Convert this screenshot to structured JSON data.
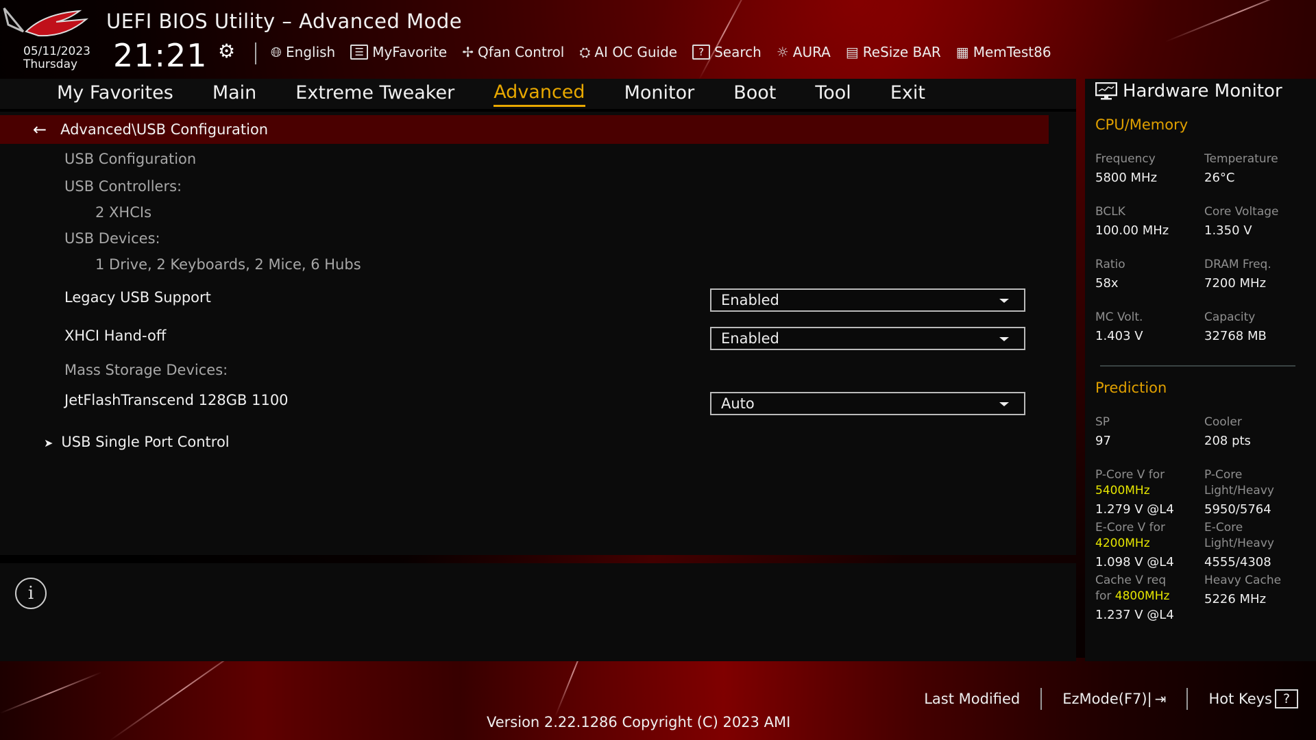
{
  "header": {
    "title": "UEFI BIOS Utility – Advanced Mode",
    "date": "05/11/2023",
    "weekday": "Thursday",
    "time": "21:21",
    "settings_icon": "gear-icon"
  },
  "toolbar": [
    {
      "label": "English",
      "icon": "globe-icon"
    },
    {
      "label": "MyFavorite",
      "icon": "favorite-list-icon"
    },
    {
      "label": "Qfan Control",
      "icon": "fan-icon"
    },
    {
      "label": "AI OC Guide",
      "icon": "ai-chip-icon"
    },
    {
      "label": "Search",
      "icon": "question-box-icon"
    },
    {
      "label": "AURA",
      "icon": "aura-light-icon"
    },
    {
      "label": "ReSize BAR",
      "icon": "gpu-card-icon"
    },
    {
      "label": "MemTest86",
      "icon": "memory-icon"
    }
  ],
  "tabs": [
    {
      "label": "My Favorites",
      "active": false
    },
    {
      "label": "Main",
      "active": false
    },
    {
      "label": "Extreme Tweaker",
      "active": false
    },
    {
      "label": "Advanced",
      "active": true
    },
    {
      "label": "Monitor",
      "active": false
    },
    {
      "label": "Boot",
      "active": false
    },
    {
      "label": "Tool",
      "active": false
    },
    {
      "label": "Exit",
      "active": false
    }
  ],
  "breadcrumb": "Advanced\\USB Configuration",
  "content": {
    "section_title": "USB Configuration",
    "controllers_label": "USB Controllers:",
    "controllers_value": "2 XHCIs",
    "devices_label": "USB Devices:",
    "devices_value": "1 Drive, 2 Keyboards, 2 Mice, 6 Hubs",
    "settings": [
      {
        "label": "Legacy USB Support",
        "value": "Enabled"
      },
      {
        "label": "XHCI Hand-off",
        "value": "Enabled"
      }
    ],
    "mass_storage_label": "Mass Storage Devices:",
    "mass_storage": [
      {
        "label": "JetFlashTranscend 128GB 1100",
        "value": "Auto"
      }
    ],
    "submenu": "USB Single Port Control"
  },
  "hardware_monitor": {
    "title": "Hardware Monitor",
    "cpu_memory": {
      "title": "CPU/Memory",
      "items": [
        {
          "label": "Frequency",
          "value": "5800 MHz"
        },
        {
          "label": "Temperature",
          "value": "26°C"
        },
        {
          "label": "BCLK",
          "value": "100.00 MHz"
        },
        {
          "label": "Core Voltage",
          "value": "1.350 V"
        },
        {
          "label": "Ratio",
          "value": "58x"
        },
        {
          "label": "DRAM Freq.",
          "value": "7200 MHz"
        },
        {
          "label": "MC Volt.",
          "value": "1.403 V"
        },
        {
          "label": "Capacity",
          "value": "32768 MB"
        }
      ]
    },
    "prediction": {
      "title": "Prediction",
      "sp_label": "SP",
      "sp_value": "97",
      "cooler_label": "Cooler",
      "cooler_value": "208 pts",
      "pcore_v_label": "P-Core V for",
      "pcore_v_freq": "5400MHz",
      "pcore_v_value": "1.279 V @L4",
      "pcore_lh_label_1": "P-Core",
      "pcore_lh_label_2": "Light/Heavy",
      "pcore_lh_value": "5950/5764",
      "ecore_v_label": "E-Core V for",
      "ecore_v_freq": "4200MHz",
      "ecore_v_value": "1.098 V @L4",
      "ecore_lh_label_1": "E-Core",
      "ecore_lh_label_2": "Light/Heavy",
      "ecore_lh_value": "4555/4308",
      "cache_v_label": "Cache V req",
      "cache_v_for": "for",
      "cache_v_freq": "4800MHz",
      "cache_v_value": "1.237 V @L4",
      "heavy_cache_label": "Heavy Cache",
      "heavy_cache_value": "5226 MHz"
    }
  },
  "footer": {
    "last_modified": "Last Modified",
    "ezmode": "EzMode(F7)|",
    "hotkeys": "Hot Keys",
    "hotkeys_icon_glyph": "?",
    "version": "Version 2.22.1286 Copyright (C) 2023 AMI"
  },
  "colors": {
    "accent_gold": "#e0a000",
    "highlight_yellow": "#e6e600",
    "breadcrumb_bg": "#4a0000"
  }
}
